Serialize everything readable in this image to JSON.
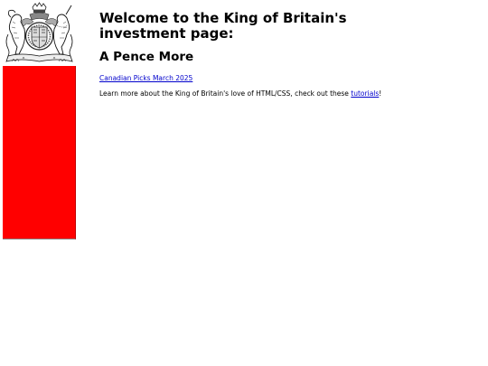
{
  "sidebar": {
    "crest_icon": "royal-coat-of-arms-icon",
    "panel_color": "#ff0000"
  },
  "main": {
    "heading": "Welcome to the King of Britain's investment page:",
    "subheading": "A Pence More",
    "picks_link": "Canadian Picks March 2025",
    "body_prefix": "Learn more about the King of Britain's love of HTML/CSS, check out these ",
    "tutorials_link": "tutorials",
    "body_suffix": "!"
  }
}
